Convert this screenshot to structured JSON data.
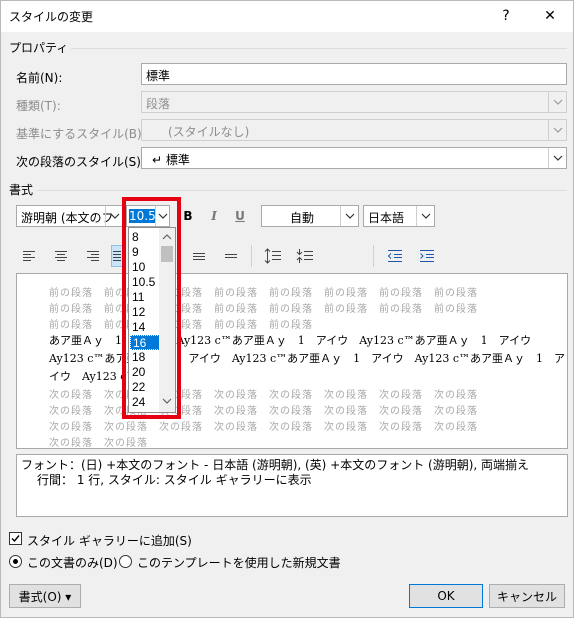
{
  "window": {
    "title": "スタイルの変更",
    "help": "?",
    "close": "✕"
  },
  "properties": {
    "group": "プロパティ",
    "name_label": "名前(N):",
    "name_value": "標準",
    "type_label": "種類(T):",
    "type_value": "段落",
    "based_label": "基準にするスタイル(B):",
    "based_value": "(スタイルなし)",
    "next_label": "次の段落のスタイル(S):",
    "next_value": "↵ 標準"
  },
  "format": {
    "group": "書式",
    "font_value": "游明朝 (本文のフ",
    "size_value": "10.5",
    "bold": "B",
    "italic": "I",
    "underline": "U",
    "color_value": "自動",
    "lang_value": "日本語"
  },
  "size_list": {
    "items": [
      "8",
      "9",
      "10",
      "10.5",
      "11",
      "12",
      "14",
      "16",
      "18",
      "20",
      "22",
      "24"
    ],
    "selected": "16"
  },
  "preview": {
    "prev_lines": [
      "前の段落　前の段落　前の段落　前の段落　前の段落　前の段落　前の段落　前の段落",
      "前の段落　前の段落　前の段落　前の段落　前の段落　前の段落　前の段落　前の段落",
      "前の段落　前の段落　前の段落　前の段落　前の段落"
    ],
    "main_lines": [
      "あア亜Ａｙ　1　アイウ　Ay123 c™あア亜Ａｙ　1　アイウ　Ay123 c™あア亜Ａｙ　1　アイウ",
      "Ay123 c™あア亜Ａｙ　1　アイウ　Ay123 c™あア亜Ａｙ　1　アイウ　Ay123 c™あア亜Ａｙ　1　ア",
      "イウ　Ay123 c™"
    ],
    "next_lines": [
      "次の段落　次の段落　次の段落　次の段落　次の段落　次の段落　次の段落　次の段落",
      "次の段落　次の段落　次の段落　次の段落　次の段落　次の段落　次の段落　次の段落",
      "次の段落　次の段落　次の段落　次の段落　次の段落　次の段落　次の段落　次の段落",
      "次の段落　次の段落"
    ]
  },
  "description": {
    "line1": "フォント：(日) +本文のフォント - 日本語 (游明朝), (英) +本文のフォント (游明朝), 両端揃え",
    "line2": "行間：  1 行, スタイル: スタイル ギャラリーに表示"
  },
  "options": {
    "add_gallery": "スタイル ギャラリーに追加(S)",
    "only_doc": "この文書のみ(D)",
    "new_docs": "このテンプレートを使用した新規文書"
  },
  "buttons": {
    "format": "書式(O) ▾",
    "ok": "OK",
    "cancel": "キャンセル"
  },
  "colors": {
    "accent": "#0078d7",
    "highlight": "#e60012"
  }
}
